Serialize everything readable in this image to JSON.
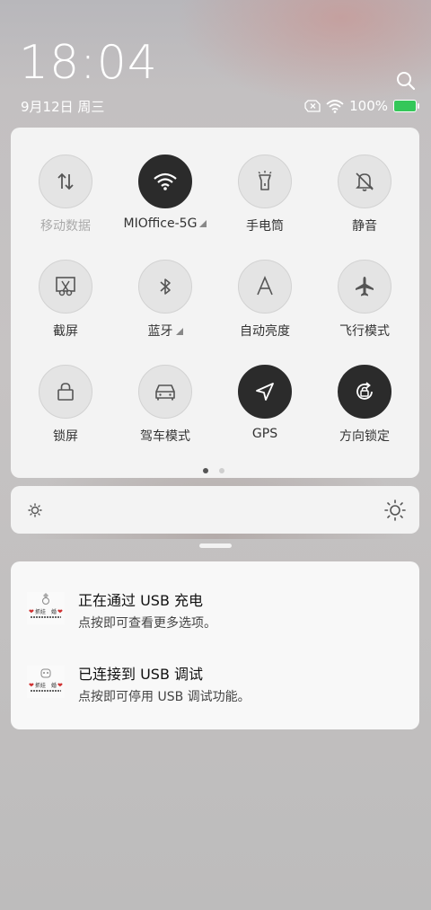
{
  "status_bar": {
    "time": "18:04",
    "date": "9月12日 周三",
    "battery": "100%",
    "icons": [
      "sim-off-icon",
      "wifi-icon",
      "battery-charging-icon"
    ]
  },
  "header": {
    "search_icon": "search-icon"
  },
  "quick_settings": {
    "tiles": [
      {
        "label": "移动数据",
        "icon": "mobile-data-icon",
        "active": false,
        "dim": true
      },
      {
        "label": "MIOffice-5G",
        "icon": "wifi-icon",
        "active": true,
        "expand": true
      },
      {
        "label": "手电筒",
        "icon": "flashlight-icon",
        "active": false
      },
      {
        "label": "静音",
        "icon": "silent-bell-icon",
        "active": false
      },
      {
        "label": "截屏",
        "icon": "screenshot-icon",
        "active": false
      },
      {
        "label": "蓝牙",
        "icon": "bluetooth-icon",
        "active": false,
        "expand": true
      },
      {
        "label": "自动亮度",
        "icon": "auto-brightness-icon",
        "active": false
      },
      {
        "label": "飞行模式",
        "icon": "airplane-icon",
        "active": false
      },
      {
        "label": "锁屏",
        "icon": "lock-icon",
        "active": false
      },
      {
        "label": "驾车模式",
        "icon": "car-icon",
        "active": false
      },
      {
        "label": "GPS",
        "icon": "navigation-icon",
        "active": true
      },
      {
        "label": "方向锁定",
        "icon": "rotation-lock-icon",
        "active": true
      }
    ],
    "page": 1,
    "page_count": 2
  },
  "brightness": {
    "level": 0.0,
    "min_icon": "brightness-low-icon",
    "max_icon": "brightness-high-icon"
  },
  "notifications": [
    {
      "title": "正在通过 USB 充电",
      "subtitle": "点按即可查看更多选项。",
      "icon": "app-icon"
    },
    {
      "title": "已连接到 USB 调试",
      "subtitle": "点按即可停用 USB 调试功能。",
      "icon": "app-icon"
    }
  ]
}
